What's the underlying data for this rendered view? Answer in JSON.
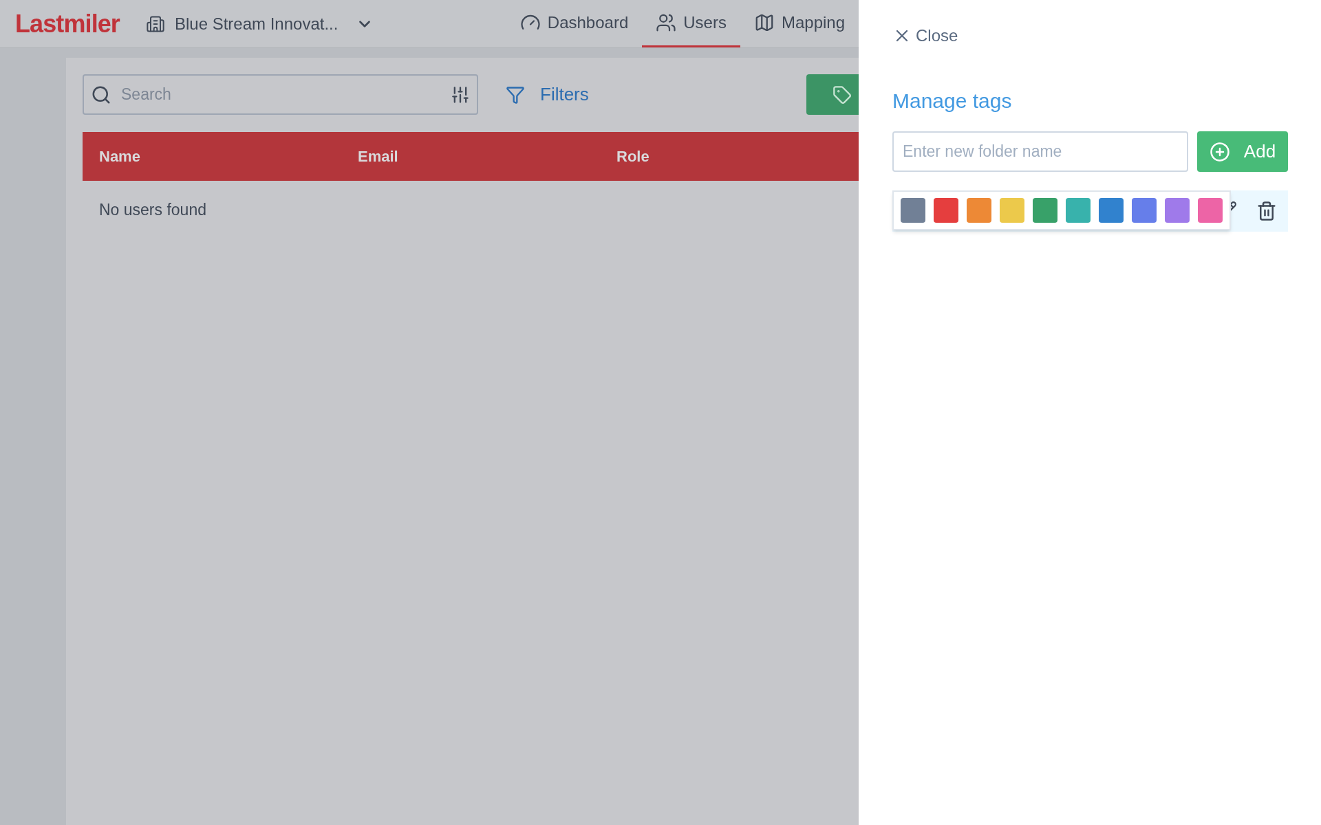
{
  "header": {
    "logo": "Lastmiler",
    "organization": "Blue Stream Innovat...",
    "nav": [
      {
        "label": "Dashboard",
        "selected": false
      },
      {
        "label": "Users",
        "selected": true
      },
      {
        "label": "Mapping",
        "selected": false
      }
    ]
  },
  "toolbar": {
    "search": {
      "placeholder": "Search"
    },
    "filters": "Filters"
  },
  "table": {
    "columns": [
      "Name",
      "Email",
      "Role"
    ],
    "empty": "No users found"
  },
  "panel": {
    "close": "Close",
    "title": "Manage tags",
    "input": {
      "placeholder": "Enter new folder name"
    },
    "add": "Add",
    "colors": [
      {
        "color": "#718096"
      },
      {
        "color": "#e53e3e"
      },
      {
        "color": "#ed8936"
      },
      {
        "color": "#ecc94b"
      },
      {
        "color": "#38a169"
      },
      {
        "color": "#38b2ac"
      },
      {
        "color": "#3182ce"
      },
      {
        "color": "#667eea"
      },
      {
        "color": "#9f7aea"
      },
      {
        "color": "#ed64a6"
      }
    ]
  }
}
